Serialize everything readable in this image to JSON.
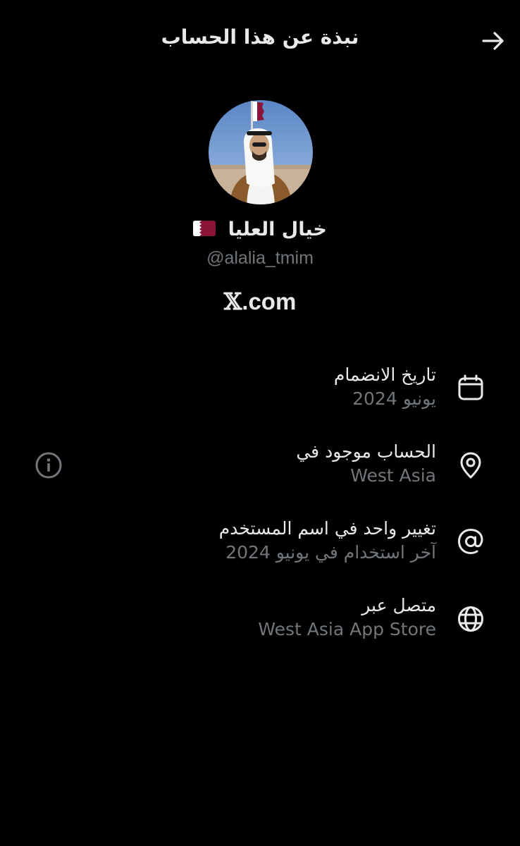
{
  "header": {
    "title": "نبذة عن هذا الحساب",
    "back_icon": "arrow-right-icon"
  },
  "profile": {
    "avatar_icon": "profile-photo",
    "display_name": "خيال العليا",
    "flag_emoji": "qatar-flag",
    "handle": "@alalia_tmim",
    "site_prefix": "𝕏",
    "site_suffix": ".com"
  },
  "details": [
    {
      "icon": "calendar-icon",
      "label": "تاريخ الانضمام",
      "value": "يونيو 2024"
    },
    {
      "icon": "location-pin-icon",
      "label": "الحساب موجود في",
      "value": "West Asia"
    },
    {
      "icon": "at-sign-icon",
      "label": "تغيير واحد في اسم المستخدم",
      "value": "آخر استخدام في يونيو 2024"
    },
    {
      "icon": "globe-icon",
      "label": "متصل عبر",
      "value": "West Asia App Store"
    }
  ],
  "info_icon": "info-icon",
  "colors": {
    "background": "#000000",
    "primary_text": "#e7e9ea",
    "secondary_text": "#71767b",
    "qatar_maroon": "#8a1538"
  }
}
